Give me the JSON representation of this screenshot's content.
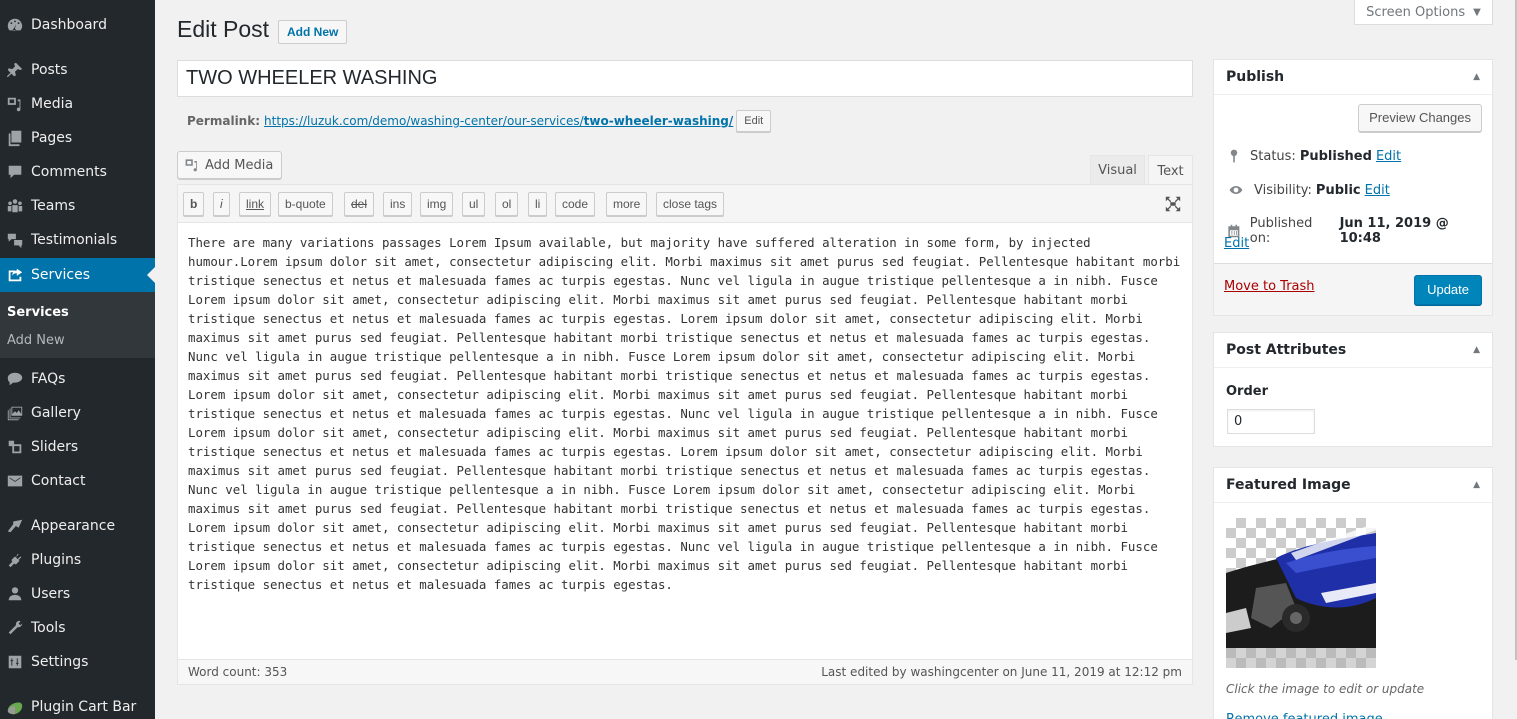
{
  "sidebar": {
    "items": [
      {
        "label": "Dashboard",
        "icon": "dashboard-icon"
      },
      {
        "label": "Posts",
        "icon": "pin-icon"
      },
      {
        "label": "Media",
        "icon": "media-icon"
      },
      {
        "label": "Pages",
        "icon": "pages-icon"
      },
      {
        "label": "Comments",
        "icon": "comment-icon"
      },
      {
        "label": "Teams",
        "icon": "groups-icon"
      },
      {
        "label": "Testimonials",
        "icon": "testimonial-icon"
      },
      {
        "label": "Services",
        "icon": "share-icon",
        "current": true
      },
      {
        "label": "FAQs",
        "icon": "chat-icon"
      },
      {
        "label": "Gallery",
        "icon": "gallery-icon"
      },
      {
        "label": "Sliders",
        "icon": "slides-icon"
      },
      {
        "label": "Contact",
        "icon": "email-icon"
      },
      {
        "label": "Appearance",
        "icon": "brush-icon"
      },
      {
        "label": "Plugins",
        "icon": "plugin-icon"
      },
      {
        "label": "Users",
        "icon": "user-icon"
      },
      {
        "label": "Tools",
        "icon": "wrench-icon"
      },
      {
        "label": "Settings",
        "icon": "settings-icon"
      },
      {
        "label": "Plugin Cart Bar",
        "icon": "cart-bar-icon"
      }
    ],
    "submenu": [
      {
        "label": "Services",
        "active": true
      },
      {
        "label": "Add New"
      }
    ]
  },
  "header": {
    "title": "Edit Post",
    "add_new_label": "Add New",
    "screen_options_label": "Screen Options"
  },
  "post": {
    "title": "TWO WHEELER WASHING",
    "permalink_label": "Permalink:",
    "permalink_base": "https://luzuk.com/demo/washing-center/our-services/",
    "permalink_slug": "two-wheeler-washing/",
    "permalink_edit_label": "Edit"
  },
  "editor": {
    "add_media_label": "Add Media",
    "tabs": {
      "visual": "Visual",
      "text": "Text"
    },
    "active_tab": "Text",
    "quicktags": [
      "b",
      "i",
      "link",
      "b-quote",
      "del",
      "ins",
      "img",
      "ul",
      "ol",
      "li",
      "code",
      "more",
      "close tags"
    ],
    "content": "There are many variations passages Lorem Ipsum available, but majority have suffered alteration in some form, by injected humour.Lorem ipsum dolor sit amet, consectetur adipiscing elit. Morbi maximus sit amet purus sed feugiat. Pellentesque habitant morbi tristique senectus et netus et malesuada fames ac turpis egestas. Nunc vel ligula in augue tristique pellentesque a in nibh. Fusce Lorem ipsum dolor sit amet, consectetur adipiscing elit. Morbi maximus sit amet purus sed feugiat. Pellentesque habitant morbi tristique senectus et netus et malesuada fames ac turpis egestas. Lorem ipsum dolor sit amet, consectetur adipiscing elit. Morbi maximus sit amet purus sed feugiat. Pellentesque habitant morbi tristique senectus et netus et malesuada fames ac turpis egestas. Nunc vel ligula in augue tristique pellentesque a in nibh. Fusce Lorem ipsum dolor sit amet, consectetur adipiscing elit. Morbi maximus sit amet purus sed feugiat. Pellentesque habitant morbi tristique senectus et netus et malesuada fames ac turpis egestas. Lorem ipsum dolor sit amet, consectetur adipiscing elit. Morbi maximus sit amet purus sed feugiat. Pellentesque habitant morbi tristique senectus et netus et malesuada fames ac turpis egestas. Nunc vel ligula in augue tristique pellentesque a in nibh. Fusce Lorem ipsum dolor sit amet, consectetur adipiscing elit. Morbi maximus sit amet purus sed feugiat. Pellentesque habitant morbi tristique senectus et netus et malesuada fames ac turpis egestas. Lorem ipsum dolor sit amet, consectetur adipiscing elit. Morbi maximus sit amet purus sed feugiat. Pellentesque habitant morbi tristique senectus et netus et malesuada fames ac turpis egestas. Nunc vel ligula in augue tristique pellentesque a in nibh. Fusce Lorem ipsum dolor sit amet, consectetur adipiscing elit. Morbi maximus sit amet purus sed feugiat. Pellentesque habitant morbi tristique senectus et netus et malesuada fames ac turpis egestas. Lorem ipsum dolor sit amet, consectetur adipiscing elit. Morbi maximus sit amet purus sed feugiat. Pellentesque habitant morbi tristique senectus et netus et malesuada fames ac turpis egestas. Nunc vel ligula in augue tristique pellentesque a in nibh. Fusce Lorem ipsum dolor sit amet, consectetur adipiscing elit. Morbi maximus sit amet purus sed feugiat. Pellentesque habitant morbi tristique senectus et netus et malesuada fames ac turpis egestas.",
    "word_count": "Word count: 353",
    "last_edited": "Last edited by washingcenter on June 11, 2019 at 12:12 pm"
  },
  "publish": {
    "title": "Publish",
    "preview_label": "Preview Changes",
    "status_label": "Status:",
    "status_value": "Published",
    "visibility_label": "Visibility:",
    "visibility_value": "Public",
    "published_on_label": "Published on:",
    "published_on_value": "Jun 11, 2019 @ 10:48",
    "edit_label": "Edit",
    "trash_label": "Move to Trash",
    "update_label": "Update"
  },
  "attributes": {
    "title": "Post Attributes",
    "order_label": "Order",
    "order_value": "0"
  },
  "featured": {
    "title": "Featured Image",
    "caption": "Click the image to edit or update",
    "remove_label": "Remove featured image"
  },
  "colors": {
    "sidebar_bg": "#23282d",
    "accent": "#0073aa",
    "button_primary": "#0085ba",
    "trash": "#aa0000"
  }
}
